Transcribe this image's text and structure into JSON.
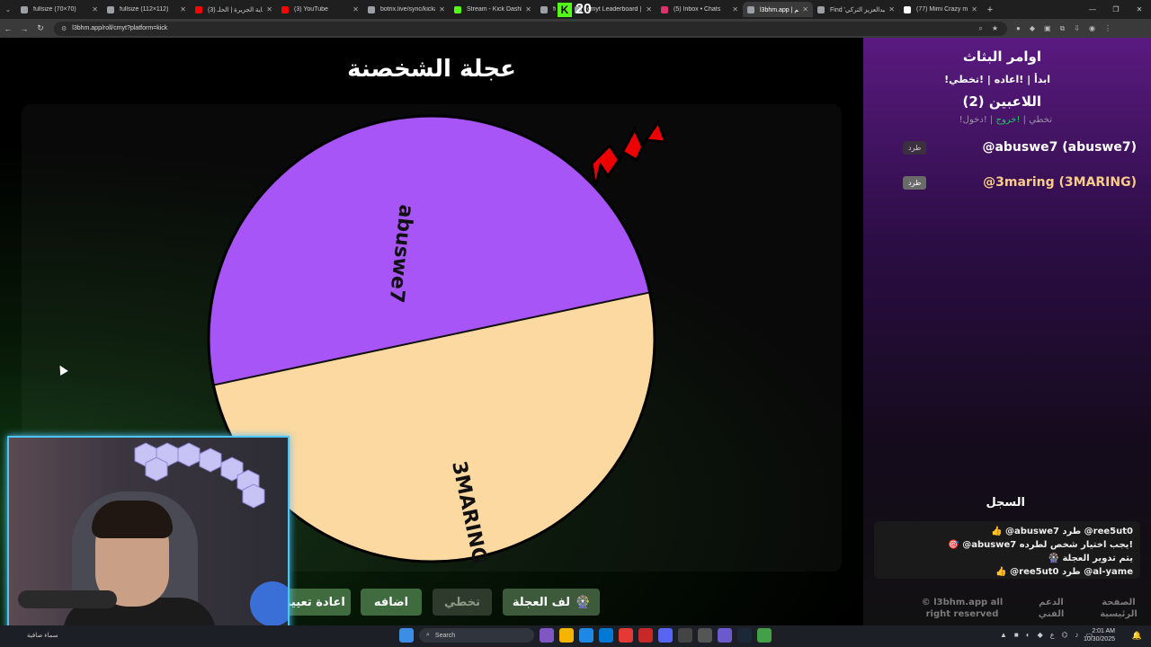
{
  "browser": {
    "tabs": [
      {
        "title": "fullsize (70×70)",
        "color": "#9aa0a6"
      },
      {
        "title": "fullsize (112×112)",
        "color": "#9aa0a6"
      },
      {
        "title": "(3) نهاية الجزيرة | الحلـ",
        "color": "#ff0000"
      },
      {
        "title": "(3) YouTube",
        "color": "#ff0000"
      },
      {
        "title": "botrix.live/sync/kickale",
        "color": "#9aa0a6"
      },
      {
        "title": "Stream - Kick Dashboa",
        "color": "#53fc18"
      },
      {
        "title": "ful",
        "color": "#9aa0a6"
      },
      {
        "title": "cmyt Leaderboard | Th",
        "color": "#9aa0a6"
      },
      {
        "title": "(5) Inbox • Chats",
        "color": "#e1306c"
      },
      {
        "title": "l3bhm.app | لعبهم",
        "color": "#9aa0a6"
      },
      {
        "title": "Find 'عبدالعزيز التركي' l",
        "color": "#9aa0a6"
      },
      {
        "title": "(77) Mimi Crazy mage",
        "color": "#ffffff"
      }
    ],
    "active_tab": 9,
    "url": "l3bhm.app/roll/cmyt?platform=kick",
    "kick_overlay": "20"
  },
  "page": {
    "title": "عجلة الشخصنة",
    "wheel": {
      "segments": [
        {
          "label": "abuswe7",
          "color": "#a855f7"
        },
        {
          "label": "3MARING",
          "color": "#fcd9a0"
        }
      ]
    },
    "buttons": {
      "spin": "لف العجلة",
      "spin_icon": "🎡",
      "skip": "تخطي",
      "add": "اضافه",
      "reset": "اعادة تعيين"
    }
  },
  "sidebar": {
    "commands_title": "اوامر البثاث",
    "commands": "!ابدأ | !اعاده | !تخطي",
    "players_title": "اللاعبين (2)",
    "join_cmd": "!دخول",
    "exit_cmd": "!خروج",
    "skip_cmd": "!تخطي",
    "players": [
      {
        "name": "@abuswe7 (abuswe7)",
        "kick": "طرد"
      },
      {
        "name": "@3maring (3MARING)",
        "kick": "طرد"
      }
    ],
    "log_title": "السجل",
    "log": [
      "👍 @abuswe7 طرد @ree5ut0",
      "🎯 @abuswe7 يجب اختيار شخص لطرده!",
      "🎡 يتم تدوير العجلة",
      "👍 @ree5ut0 طرد @al-yame"
    ],
    "footer": {
      "home": "الصفحة الرئيسية",
      "support": "الدعم الفني",
      "rights": "© l3bhm.app all right reserved"
    }
  },
  "taskbar": {
    "weather": "سماء صافية",
    "search": "Search",
    "time": "2:01 AM",
    "date": "10/30/2025",
    "lang": "ع"
  }
}
